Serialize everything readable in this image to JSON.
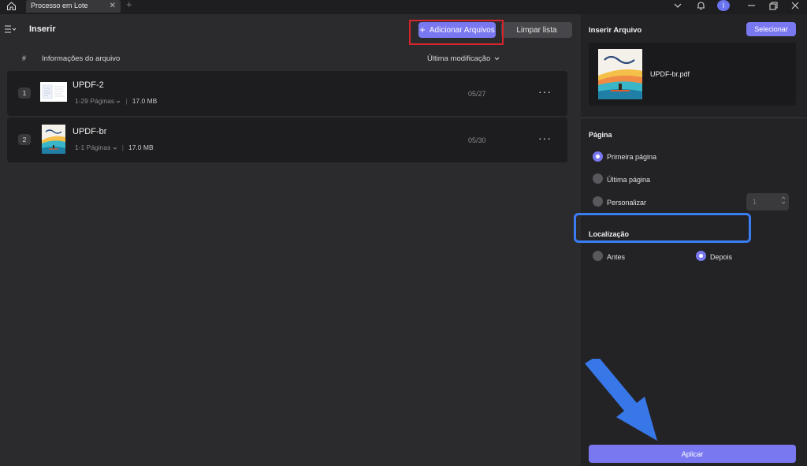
{
  "titlebar": {
    "tab_label": "Processo em Lote",
    "tab_close": "✕",
    "tab_add": "+",
    "avatar_letter": "I"
  },
  "left": {
    "title": "Inserir",
    "add_button": "Adicionar Arquivos",
    "add_icon": "+",
    "clear_button": "Limpar lista",
    "col_hash": "#",
    "col_info": "Informações do arquivo",
    "col_modified": "Última modificação",
    "files": [
      {
        "num": "1",
        "name": "UPDF-2",
        "pages": "1-29 Páginas",
        "size": "17.0 MB",
        "date": "05/27",
        "more": "···"
      },
      {
        "num": "2",
        "name": "UPDF-br",
        "pages": "1-1 Páginas",
        "size": "17.0 MB",
        "date": "05/30",
        "more": "···"
      }
    ]
  },
  "right": {
    "title": "Inserir Arquivo",
    "select_button": "Selecionar",
    "file_name": "UPDF-br.pdf",
    "page_section": "Página",
    "opt_first": "Primeira página",
    "opt_last": "Última página",
    "opt_custom": "Personalizar",
    "custom_value": "1",
    "location_section": "Localização",
    "opt_before": "Antes",
    "opt_after": "Depois",
    "apply_button": "Aplicar"
  },
  "colors": {
    "accent": "#7a78f0",
    "highlight_red": "#d6252a",
    "highlight_blue": "#3a7cf2"
  }
}
